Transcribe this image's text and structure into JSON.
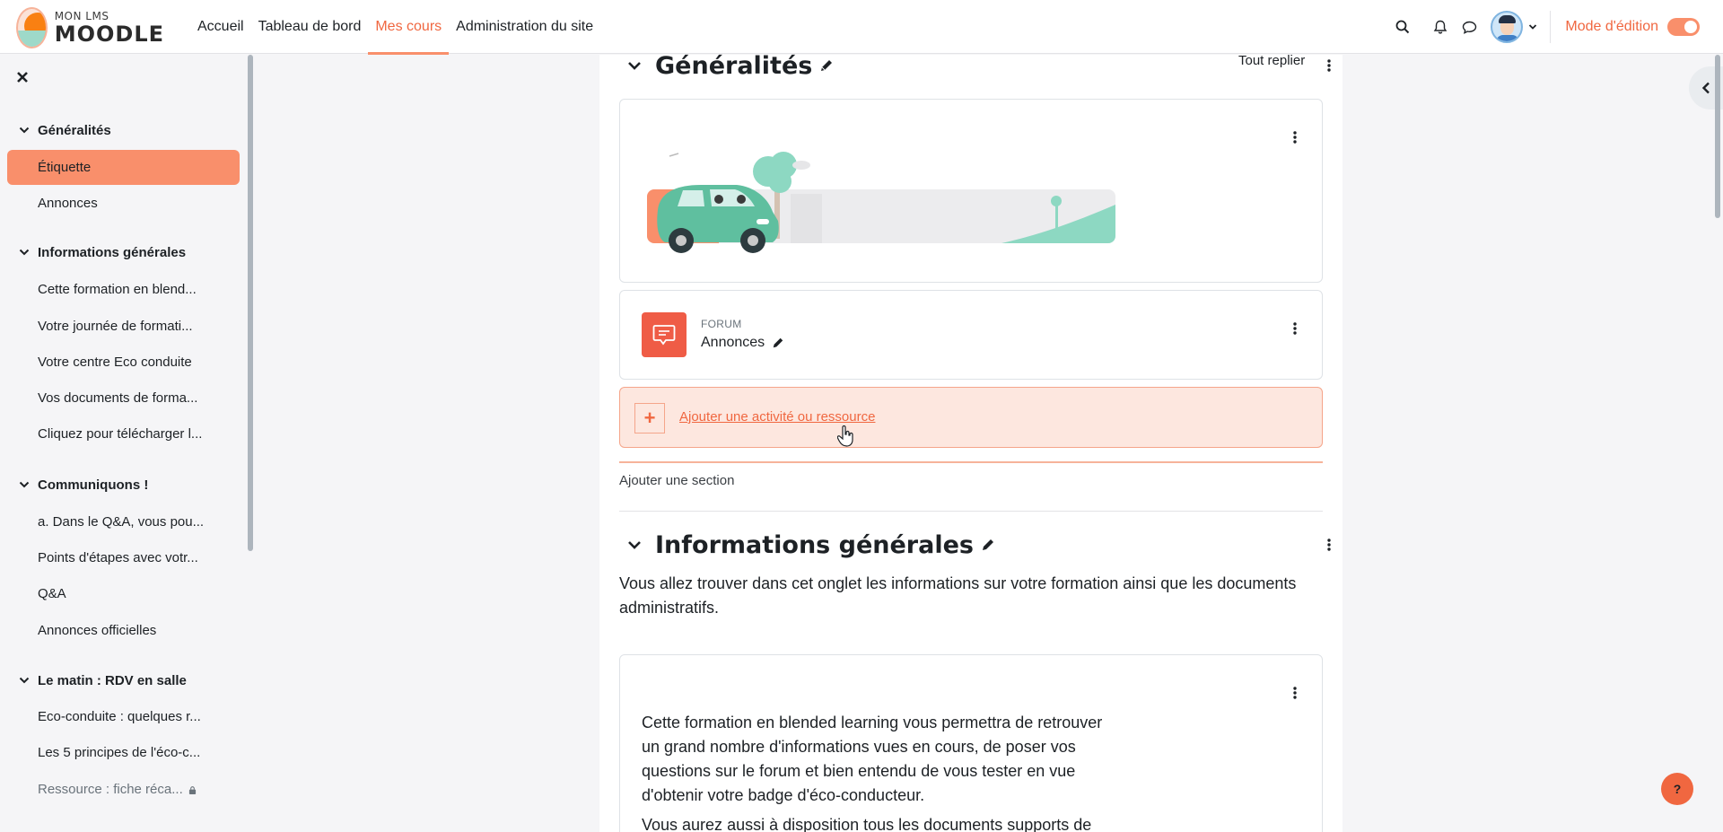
{
  "logo": {
    "line1": "MON LMS",
    "line2": "MOODLE"
  },
  "nav": {
    "items": [
      {
        "label": "Accueil"
      },
      {
        "label": "Tableau de bord"
      },
      {
        "label": "Mes cours"
      },
      {
        "label": "Administration du site"
      }
    ],
    "edit_mode_label": "Mode d'édition",
    "edit_mode_on": true
  },
  "drawer": {
    "sections": [
      {
        "label": "Généralités"
      },
      {
        "label": "Informations générales"
      },
      {
        "label": "Communiquons !"
      },
      {
        "label": "Le matin : RDV en salle"
      }
    ],
    "items": [
      {
        "label": "Étiquette"
      },
      {
        "label": "Annonces"
      },
      {
        "label": "Cette formation en blend..."
      },
      {
        "label": "Votre journée de formati..."
      },
      {
        "label": "Votre centre Eco conduite"
      },
      {
        "label": "Vos documents de forma..."
      },
      {
        "label": "Cliquez pour télécharger l..."
      },
      {
        "label": "a. Dans le Q&A, vous pou..."
      },
      {
        "label": "Points d'étapes avec votr..."
      },
      {
        "label": "Q&A"
      },
      {
        "label": "Annonces officielles"
      },
      {
        "label": "Eco-conduite : quelques r..."
      },
      {
        "label": "Les 5 principes de l'éco-c..."
      },
      {
        "label": "Ressource : fiche réca..."
      }
    ]
  },
  "main": {
    "section1": {
      "title": "Généralités",
      "collapse_all": "Tout replier",
      "forum": {
        "type": "FORUM",
        "name": "Annonces"
      },
      "add_activity": "Ajouter une activité ou ressource",
      "add_section": "Ajouter une section"
    },
    "section2": {
      "title": "Informations générales",
      "summary": "Vous allez trouver dans cet onglet les informations sur votre formation ainsi que les documents administratifs.",
      "card_text_1": "Cette formation en blended learning vous permettra de retrouver un grand nombre d'informations vues en cours, de poser vos questions sur le forum et bien entendu de vous tester en vue d'obtenir votre badge d'éco-conducteur.",
      "card_text_2": "Vous aurez aussi à disposition tous les documents supports de"
    }
  },
  "help": {
    "label": "?"
  },
  "colors": {
    "accent": "#f06740",
    "accent_light": "#f98f6b",
    "forum_icon": "#ef5c46"
  }
}
